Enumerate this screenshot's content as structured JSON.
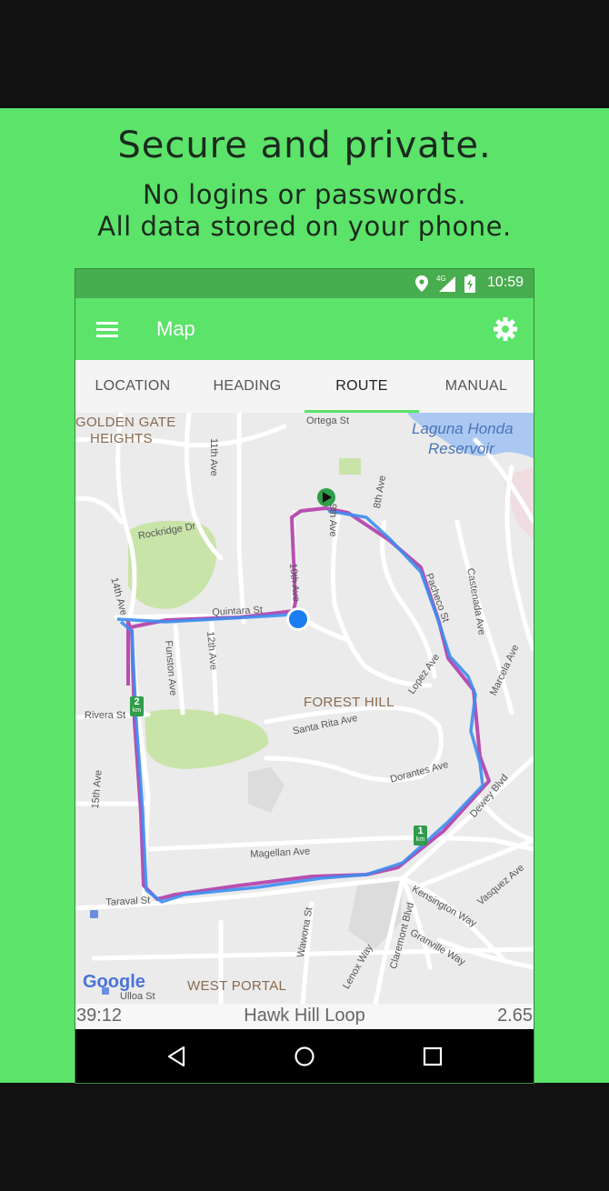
{
  "promo": {
    "headline": "Secure and private.",
    "line1": "No logins or passwords.",
    "line2": "All data stored on your phone.",
    "background": "#5ce36a"
  },
  "status_bar": {
    "time": "10:59",
    "network": "4G",
    "icons": [
      "location-pin-icon",
      "signal-icon",
      "battery-charging-icon"
    ]
  },
  "app_bar": {
    "title": "Map",
    "menu_icon": "hamburger-menu-icon",
    "settings_icon": "gear-icon"
  },
  "tabs": [
    {
      "label": "LOCATION",
      "active": false
    },
    {
      "label": "HEADING",
      "active": false
    },
    {
      "label": "ROUTE",
      "active": true
    },
    {
      "label": "MANUAL",
      "active": false
    }
  ],
  "map": {
    "areas": {
      "golden_gate_1": "GOLDEN GATE",
      "golden_gate_2": "HEIGHTS",
      "forest_hill": "FOREST HILL",
      "west_portal": "WEST PORTAL"
    },
    "water": {
      "laguna_1": "Laguna Honda",
      "laguna_2": "Reservoir"
    },
    "streets": {
      "eleventh": "11th Ave",
      "ortega": "Ortega St",
      "ninth": "9th Ave",
      "eighth": "8th Ave",
      "rockridge": "Rockridge Dr",
      "fourteenth": "14th Ave",
      "quintara": "Quintara St",
      "tenth": "10th Ave",
      "pacheco": "Pacheco St",
      "castenada": "Castenada Ave",
      "funston": "Funston Ave",
      "twelfth": "12th Ave",
      "lopez": "Lopez Ave",
      "marcela": "Marcela Ave",
      "rivera": "Rivera St",
      "santa_rita": "Santa Rita Ave",
      "fifteenth": "15th Ave",
      "dorantes": "Dorantes Ave",
      "dewey": "Dewey Blvd",
      "magellan": "Magellan Ave",
      "vasquez": "Vasquez Ave",
      "taraval": "Taraval St",
      "kensington": "Kensington Way",
      "wawona": "Wawona St",
      "claremont": "Claremont Blvd",
      "granville": "Granville Way",
      "lenox": "Lenox Way",
      "ulloa": "Ulloa St"
    },
    "km_markers": [
      {
        "value": "2",
        "unit": "km"
      },
      {
        "value": "1",
        "unit": "km"
      }
    ],
    "logo": "Google",
    "route_colors": {
      "planned": "#b84fb0",
      "tracked": "#3d8ef0"
    }
  },
  "info_bar": {
    "elapsed": "39:12",
    "route_name": "Hawk Hill Loop",
    "distance": "2.65"
  },
  "nav_bar": {
    "icons": [
      "back-icon",
      "home-icon",
      "recents-icon"
    ]
  }
}
